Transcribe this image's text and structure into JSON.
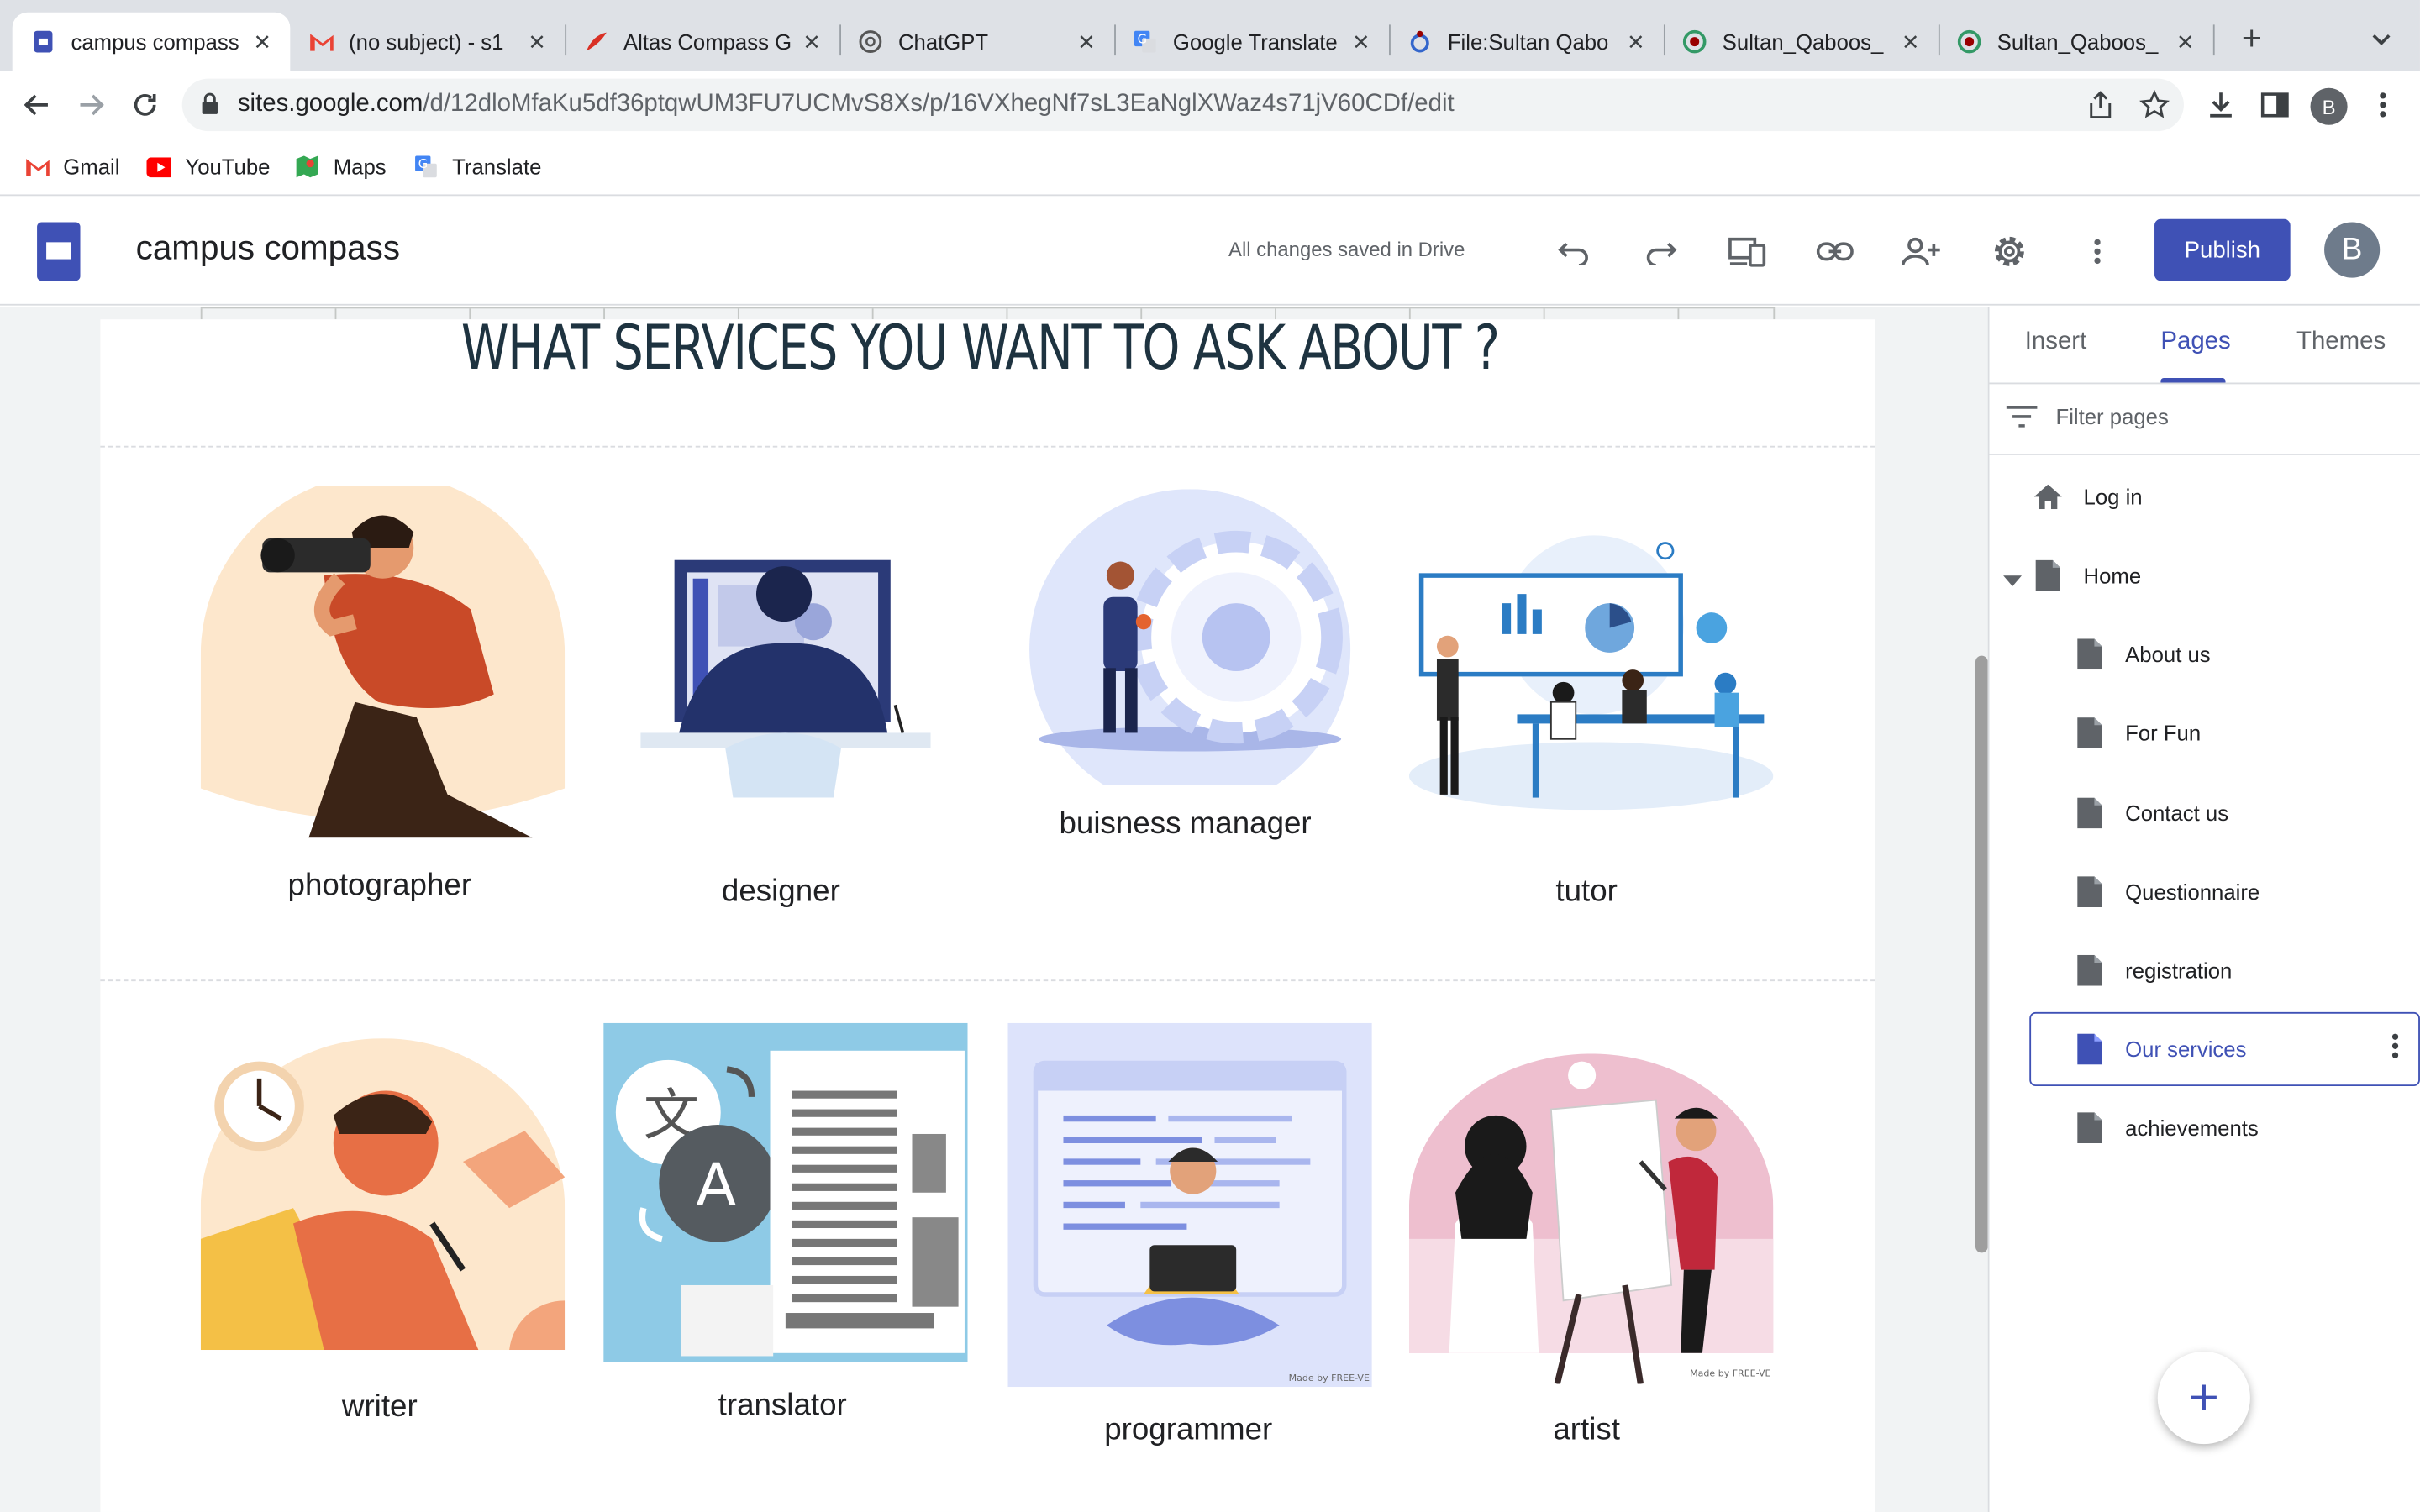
{
  "browser": {
    "tabs": [
      {
        "title": "campus compass",
        "active": true
      },
      {
        "title": "(no subject) - s1"
      },
      {
        "title": "Altas Compass G"
      },
      {
        "title": "ChatGPT"
      },
      {
        "title": "Google Translate"
      },
      {
        "title": "File:Sultan Qabo"
      },
      {
        "title": "Sultan_Qaboos_"
      },
      {
        "title": "Sultan_Qaboos_"
      }
    ],
    "url_host": "sites.google.com",
    "url_path": "/d/12dloMfaKu5df36ptqwUM3FU7UCMvS8Xs/p/16VXhegNf7sL3EaNglXWaz4s71jV60CDf/edit",
    "profile_initial": "B",
    "bookmarks": [
      "Gmail",
      "YouTube",
      "Maps",
      "Translate"
    ]
  },
  "sites": {
    "title": "campus compass",
    "save_status": "All changes saved in Drive",
    "publish_label": "Publish",
    "avatar_initial": "B"
  },
  "page": {
    "heading": "WHAT SERVICES YOU WANT TO ASK ABOUT ?",
    "services_row1": [
      "photographer",
      "designer",
      "buisness manager",
      "tutor"
    ],
    "services_row2": [
      "writer",
      "translator",
      "programmer",
      "artist"
    ],
    "watermark": "Made by FREE-VE"
  },
  "panel": {
    "tabs": [
      "Insert",
      "Pages",
      "Themes"
    ],
    "active_tab": "Pages",
    "filter_placeholder": "Filter pages",
    "pages": [
      "Log in",
      "Home",
      "About us",
      "For Fun",
      "Contact us",
      "Questionnaire",
      "registration",
      "Our services",
      "achievements"
    ],
    "selected_page": "Our services"
  },
  "colors": {
    "accent": "#3f51b5",
    "heading": "#1e3340"
  }
}
